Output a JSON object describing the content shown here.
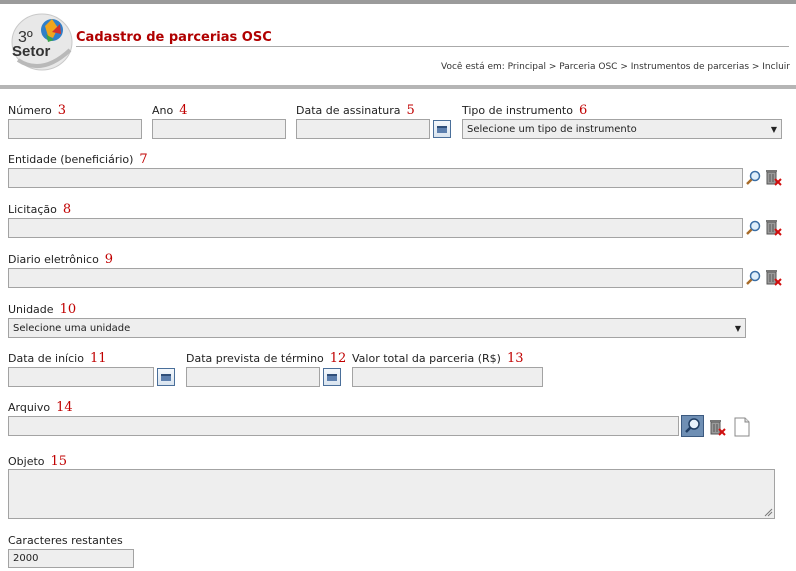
{
  "header": {
    "title": "Cadastro de parcerias OSC",
    "breadcrumb": "Você está em: Principal > Parceria OSC > Instrumentos de parcerias > Incluir",
    "logo": {
      "line1": "3º",
      "line2": "Setor"
    }
  },
  "form": {
    "numero": {
      "label": "Número",
      "marker": "3",
      "value": ""
    },
    "ano": {
      "label": "Ano",
      "marker": "4",
      "value": ""
    },
    "data_assinatura": {
      "label": "Data de assinatura",
      "marker": "5",
      "value": ""
    },
    "tipo_instrumento": {
      "label": "Tipo de instrumento",
      "marker": "6",
      "selected": "Selecione um tipo de instrumento"
    },
    "entidade": {
      "label": "Entidade (beneficiário)",
      "marker": "7",
      "value": ""
    },
    "licitacao": {
      "label": "Licitação",
      "marker": "8",
      "value": ""
    },
    "diario": {
      "label": "Diario eletrônico",
      "marker": "9",
      "value": ""
    },
    "unidade": {
      "label": "Unidade",
      "marker": "10",
      "selected": "Selecione uma unidade"
    },
    "data_inicio": {
      "label": "Data de início",
      "marker": "11",
      "value": ""
    },
    "data_termino": {
      "label": "Data prevista de término",
      "marker": "12",
      "value": ""
    },
    "valor_total": {
      "label": "Valor total da parceria (R$)",
      "marker": "13",
      "value": ""
    },
    "arquivo": {
      "label": "Arquivo",
      "marker": "14",
      "value": ""
    },
    "objeto": {
      "label": "Objeto",
      "marker": "15",
      "value": ""
    },
    "caracteres": {
      "label": "Caracteres restantes",
      "value": "2000"
    }
  },
  "icons": {
    "search": "magnifier-icon",
    "clear": "trash-clear-icon",
    "calendar": "calendar-icon",
    "file": "document-icon"
  },
  "colors": {
    "title": "#b00000",
    "marker": "#c00000",
    "field_bg": "#eeeeee"
  }
}
